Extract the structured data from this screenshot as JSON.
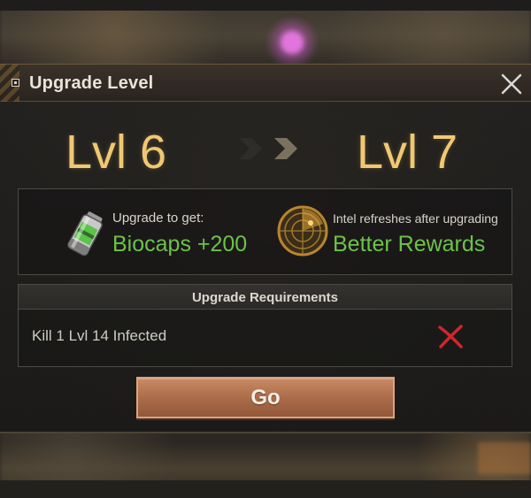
{
  "dialog": {
    "title": "Upgrade Level",
    "close_icon": "close-icon"
  },
  "levels": {
    "from": "Lvl 6",
    "to": "Lvl 7",
    "arrow_icon": "double-chevron-right-icon"
  },
  "rewards": {
    "left": {
      "caption": "Upgrade to get:",
      "value": "Biocaps +200",
      "icon": "biocaps-battery-icon"
    },
    "right": {
      "caption": "Intel refreshes after upgrading",
      "value": "Better Rewards",
      "icon": "radar-icon"
    }
  },
  "requirements": {
    "header": "Upgrade Requirements",
    "items": [
      {
        "text": "Kill 1 Lvl 14 Infected",
        "status_icon": "red-x-icon",
        "met": false
      }
    ]
  },
  "actions": {
    "go_label": "Go"
  },
  "colors": {
    "level_text": "#f0c873",
    "reward_green": "#6cc24a",
    "go_button": "#b5734f",
    "unmet_red": "#d0262c"
  }
}
